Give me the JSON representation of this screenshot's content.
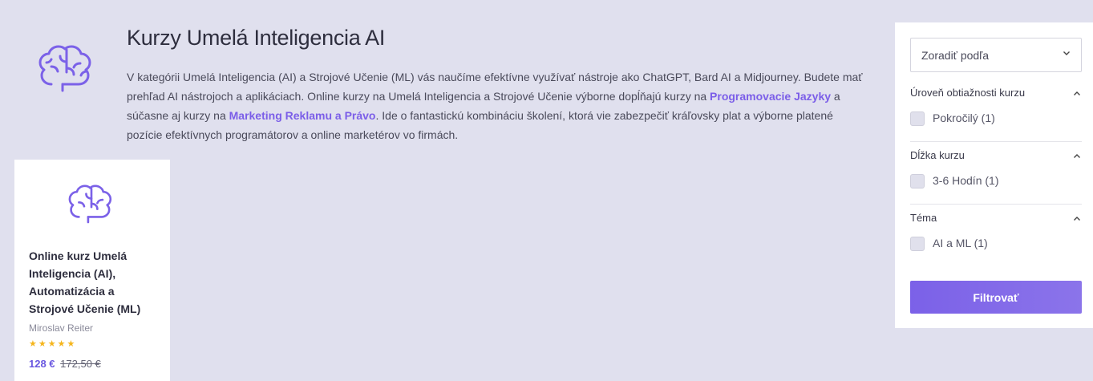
{
  "header": {
    "title": "Kurzy Umelá Inteligencia AI",
    "hero_icon": "brain-icon"
  },
  "intro": {
    "part1": "V kategórii Umelá Inteligencia (AI) a Strojové Učenie (ML) vás naučíme efektívne využívať nástroje ako ChatGPT, Bard AI a Midjourney. Budete mať prehľad AI nástrojoch a aplikáciach. Online kurzy na Umelá Inteligencia a Strojové Učenie výborne dopĺňajú kurzy na ",
    "link1": "Programovacie Jazyky",
    "part2": " a súčasne aj kurzy na ",
    "link2": "Marketing Reklamu a Právo",
    "part3": ". Ide o fantastickú kombináciu školení, ktorá vie zabezpečiť kráľovsky plat a výborne platené pozície efektívnych programátorov a online marketérov vo firmách."
  },
  "course": {
    "icon": "brain-icon",
    "title": "Online kurz Umelá Inteligencia (AI), Automatizácia a Strojové Učenie (ML)",
    "author": "Miroslav Reiter",
    "rating": 5,
    "stars": "★★★★★",
    "price": "128 €",
    "old_price": "172,50 €"
  },
  "filters": {
    "sort_placeholder": "Zoradiť podľa",
    "groups": [
      {
        "title": "Úroveň obtiažnosti kurzu",
        "options": [
          {
            "label": "Pokročilý (1)",
            "checked": false
          }
        ]
      },
      {
        "title": "Dĺžka kurzu",
        "options": [
          {
            "label": "3-6 Hodín (1)",
            "checked": false
          }
        ]
      },
      {
        "title": "Téma",
        "options": [
          {
            "label": "AI a ML (1)",
            "checked": false
          }
        ]
      }
    ],
    "button_label": "Filtrovať"
  },
  "colors": {
    "accent": "#7b5ee8",
    "background": "#e0e0ee",
    "star": "#f5b51c"
  }
}
